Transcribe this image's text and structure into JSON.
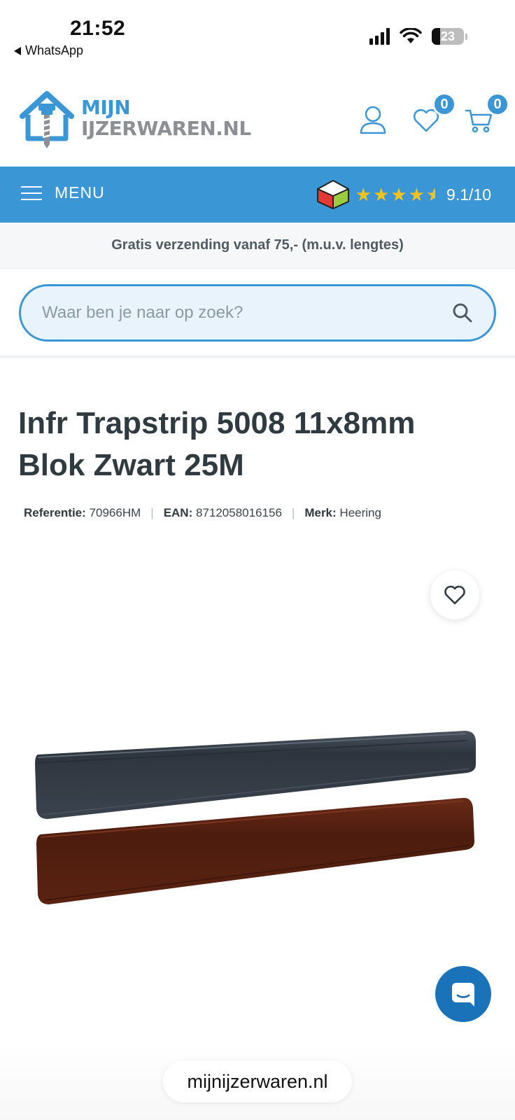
{
  "status_bar": {
    "time": "21:52",
    "back_app": "WhatsApp",
    "battery": "23"
  },
  "header": {
    "logo_line1": "MIJN",
    "logo_line2": "IJZERWAREN.NL",
    "wishlist_count": "0",
    "cart_count": "0"
  },
  "menu_bar": {
    "menu_label": "MENU",
    "rating": "9.1/10",
    "stars": 4.5
  },
  "shipping_notice": "Gratis verzending vanaf 75,- (m.u.v. lengtes)",
  "search": {
    "placeholder": "Waar ben je naar op zoek?"
  },
  "product": {
    "title": "Infr Trapstrip 5008 11x8mm Blok Zwart 25M",
    "ref_label": "Referentie:",
    "ref_value": "70966HM",
    "ean_label": "EAN:",
    "ean_value": "8712058016156",
    "brand_label": "Merk:",
    "brand_value": "Heering"
  },
  "browser": {
    "url": "mijnijzerwaren.nl"
  },
  "colors": {
    "brand_blue": "#3b96d6",
    "star_yellow": "#f8c21c",
    "chat_blue": "#1a73b8"
  }
}
